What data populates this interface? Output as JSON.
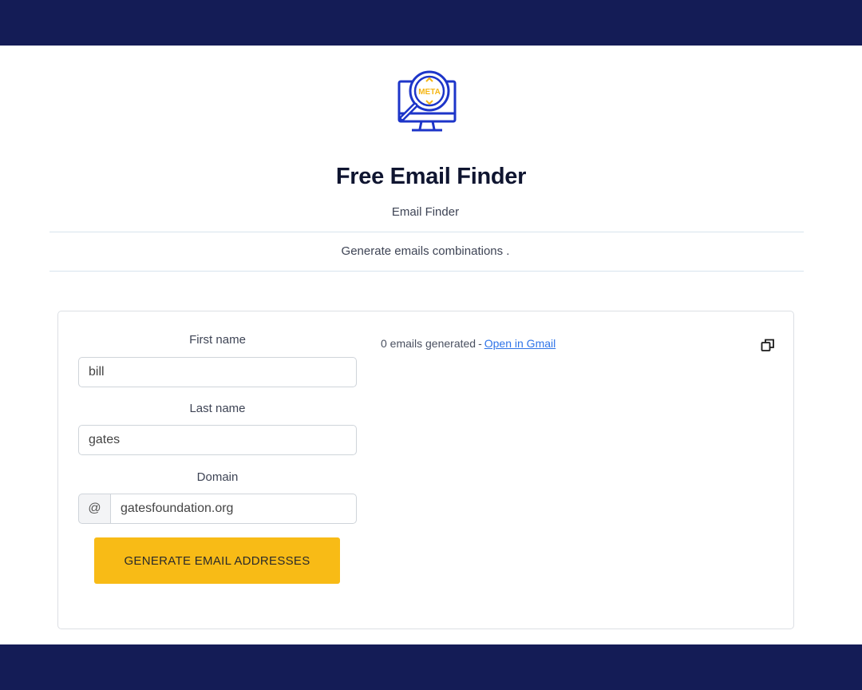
{
  "logo": {
    "text": "META",
    "icon": "magnifier-monitor-icon"
  },
  "header": {
    "title": "Free Email Finder",
    "subtitle": "Email Finder",
    "description": "Generate emails combinations ."
  },
  "form": {
    "first_name": {
      "label": "First name",
      "value": "bill"
    },
    "last_name": {
      "label": "Last name",
      "value": "gates"
    },
    "domain": {
      "label": "Domain",
      "prefix": "@",
      "value": "gatesfoundation.org"
    },
    "generate_label": "GENERATE EMAIL ADDRESSES"
  },
  "results": {
    "count_text": "0 emails generated",
    "separator": "-",
    "gmail_link": "Open in Gmail",
    "copy_icon": "copy-icon"
  },
  "colors": {
    "nav_bg": "#141c56",
    "accent": "#f8bb16",
    "link": "#2f74e8",
    "logo_blue": "#1d35c9",
    "logo_yellow": "#f5b615"
  }
}
